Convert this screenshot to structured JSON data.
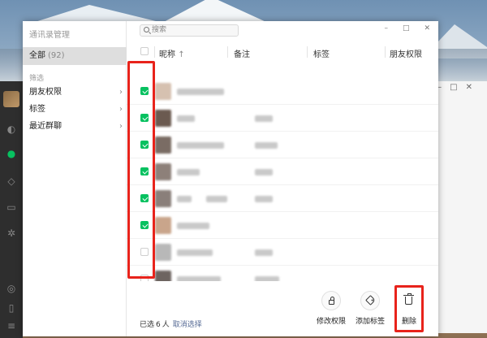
{
  "window": {
    "title": "通讯录管理",
    "controls": [
      "–",
      "□",
      "✕"
    ],
    "bg_controls": [
      "–",
      "□",
      "✕"
    ]
  },
  "sidebar": {
    "all_label": "全部",
    "all_count": "(92)",
    "filter_heading": "筛选",
    "filters": [
      {
        "label": "朋友权限",
        "chevron": "›"
      },
      {
        "label": "标签",
        "chevron": "›"
      },
      {
        "label": "最近群聊",
        "chevron": "›"
      }
    ]
  },
  "search": {
    "placeholder": "搜索"
  },
  "table": {
    "headers": {
      "nickname": "昵称",
      "sort_arrow": "↑",
      "remark": "备注",
      "tags": "标签",
      "permission": "朋友权限"
    },
    "rows": [
      {
        "checked": true
      },
      {
        "checked": true
      },
      {
        "checked": true
      },
      {
        "checked": true
      },
      {
        "checked": true
      },
      {
        "checked": true
      },
      {
        "checked": false
      },
      {
        "checked": false
      }
    ]
  },
  "footer": {
    "selected_prefix": "已选",
    "selected_count": "6",
    "selected_suffix": "人",
    "cancel_selection": "取消选择"
  },
  "actions": [
    {
      "label": "修改权限",
      "icon": "lock-icon"
    },
    {
      "label": "添加标签",
      "icon": "tag-icon"
    },
    {
      "label": "删除",
      "icon": "trash-icon"
    }
  ],
  "colors": {
    "accent_green": "#07c160",
    "highlight_red": "#e8231b",
    "link_blue": "#576b95"
  }
}
